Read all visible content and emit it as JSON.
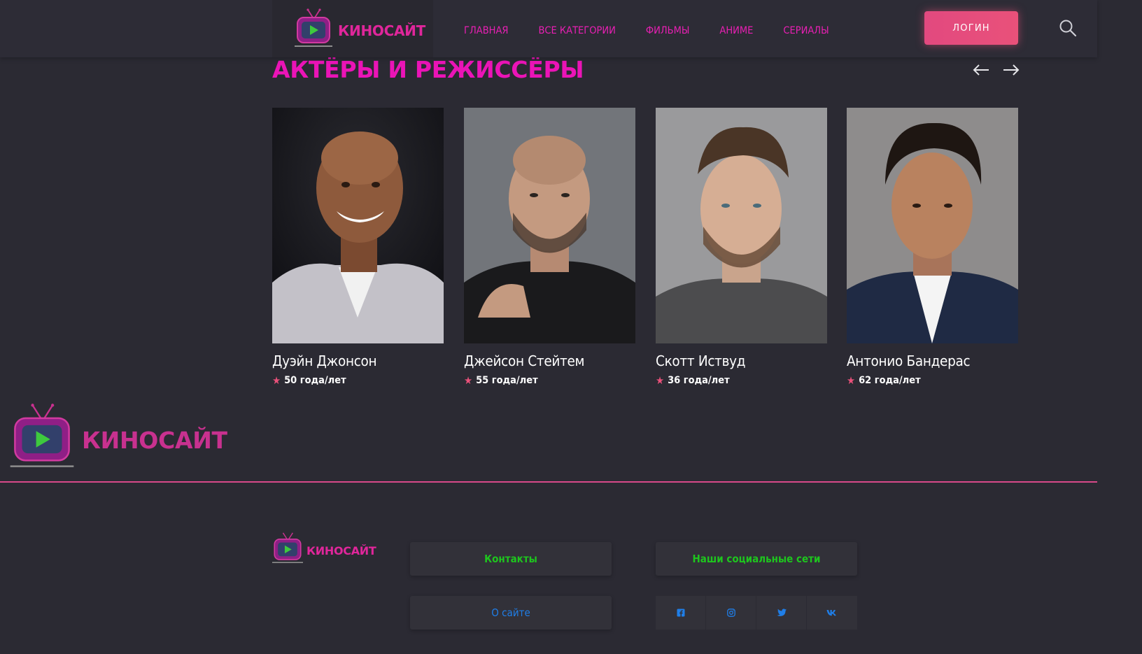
{
  "header": {
    "logo_text": "КИНОСАЙТ",
    "nav": [
      {
        "label": "ГЛАВНАЯ"
      },
      {
        "label": "ВСЕ КАТЕГОРИИ"
      },
      {
        "label": "ФИЛЬМЫ"
      },
      {
        "label": "АНИМЕ"
      },
      {
        "label": "СЕРИАЛЫ"
      }
    ],
    "login_label": "ЛОГИН",
    "search_icon": "search-icon"
  },
  "section": {
    "title": "АКТЁРЫ И РЕЖИССЁРЫ",
    "prev_icon": "arrow-left-icon",
    "next_icon": "arrow-right-icon"
  },
  "actors": [
    {
      "name": "Дуэйн Джонсон",
      "age": "50 года/лет"
    },
    {
      "name": "Джейсон Стейтем",
      "age": "55 года/лет"
    },
    {
      "name": "Скотт Иствуд",
      "age": "36 года/лет"
    },
    {
      "name": "Антонио Бандерас",
      "age": "62 года/лет"
    }
  ],
  "big_logo_text": "КИНОСАЙТ",
  "footer": {
    "logo_text": "КИНОСАЙТ",
    "contacts_label": "Контакты",
    "social_title": "Наши социальные сети",
    "about_label": "О сайте",
    "socials": [
      "facebook-icon",
      "instagram-icon",
      "twitter-icon",
      "vk-icon"
    ]
  },
  "colors": {
    "background": "#2b2a33",
    "accent_magenta": "#eb14b7",
    "logo_pink": "#e0269b",
    "button_pink": "#e9517a",
    "footer_green": "#1ec51e",
    "footer_blue": "#1f7ee8"
  }
}
